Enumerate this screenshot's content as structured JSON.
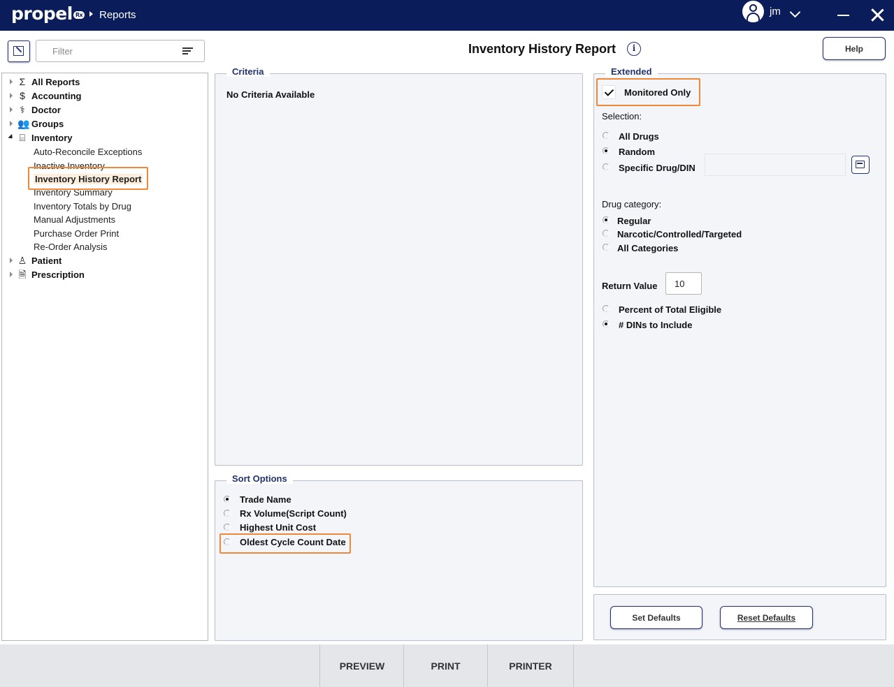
{
  "titlebar": {
    "logo": "propel",
    "logo_badge": "Rx",
    "breadcrumb": "Reports",
    "user": "jm"
  },
  "toolbar": {
    "filter_placeholder": "Filter",
    "page_title": "Inventory History Report",
    "help_label": "Help"
  },
  "tree": {
    "nodes": [
      {
        "label": "All Reports",
        "icon": "sigma-icon"
      },
      {
        "label": "Accounting",
        "icon": "dollar-icon"
      },
      {
        "label": "Doctor",
        "icon": "stethoscope-icon"
      },
      {
        "label": "Groups",
        "icon": "users-icon"
      },
      {
        "label": "Inventory",
        "icon": "pill-bottle-icon",
        "expanded": true
      },
      {
        "label": "Patient",
        "icon": "user-icon"
      },
      {
        "label": "Prescription",
        "icon": "document-icon"
      }
    ],
    "inventory_children": [
      "Auto-Reconcile Exceptions",
      "Inactive Inventory",
      "Inventory History Report",
      "Inventory Summary",
      "Inventory Totals by Drug",
      "Manual Adjustments",
      "Purchase Order Print",
      "Re-Order Analysis"
    ],
    "selected": "Inventory History Report"
  },
  "criteria": {
    "legend": "Criteria",
    "message": "No Criteria Available"
  },
  "sort": {
    "legend": "Sort Options",
    "options": [
      "Trade Name",
      "Rx Volume(Script Count)",
      "Highest Unit Cost",
      "Oldest Cycle Count Date"
    ],
    "selected": "Trade Name"
  },
  "extended": {
    "legend": "Extended",
    "monitored_label": "Monitored Only",
    "monitored_checked": true,
    "selection_label": "Selection:",
    "selection_options": [
      "All Drugs",
      "Random",
      "Specific Drug/DIN"
    ],
    "selection_selected": "Random",
    "category_label": "Drug category:",
    "category_options": [
      "Regular",
      "Narcotic/Controlled/Targeted",
      "All Categories"
    ],
    "category_selected": "Regular",
    "return_label": "Return Value",
    "return_value": "10",
    "return_options": [
      "Percent of Total Eligible",
      "# DINs to Include"
    ],
    "return_selected": "# DINs to Include"
  },
  "defaults": {
    "set_label": "Set Defaults",
    "reset_label": "Reset Defaults"
  },
  "bottom": {
    "preview": "PREVIEW",
    "print": "PRINT",
    "printer": "PRINTER"
  },
  "colors": {
    "titlebar": "#0b1c5a",
    "accent": "#23307a",
    "highlight": "#f0883a",
    "panel": "#f3f5f9"
  }
}
